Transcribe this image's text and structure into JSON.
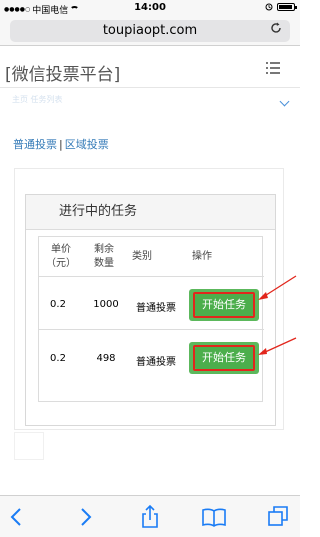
{
  "status_bar": {
    "signal": "●●●●○",
    "carrier": "中国电信",
    "time": "14:00"
  },
  "browser": {
    "url": "toupiaopt.com"
  },
  "site": {
    "title": "[微信投票平台]",
    "faded_nav": "主页  任务列表"
  },
  "links": {
    "normal_vote": "普通投票",
    "separator": "|",
    "region_vote": "区域投票"
  },
  "panel": {
    "title": "进行中的任务",
    "headers": {
      "unit_price_line1": "单价",
      "unit_price_line2": "（元）",
      "remaining_line1": "剩余",
      "remaining_line2": "数量",
      "category": "类别",
      "action": "操作"
    },
    "rows": [
      {
        "price": "0.2",
        "remaining": "1000",
        "category": "普通投票",
        "button": "开始任务"
      },
      {
        "price": "0.2",
        "remaining": "498",
        "category": "普通投票",
        "button": "开始任务"
      }
    ]
  },
  "colors": {
    "link": "#337ab7",
    "button_green": "#5cb85c",
    "highlight_red": "#e2261c",
    "ios_blue": "#1a7cf5"
  },
  "icons": {
    "menu": "menu-icon",
    "reload": "reload-icon",
    "back": "back-icon",
    "forward": "forward-icon",
    "share": "share-icon",
    "bookmarks": "bookmarks-icon",
    "tabs": "tabs-icon"
  }
}
